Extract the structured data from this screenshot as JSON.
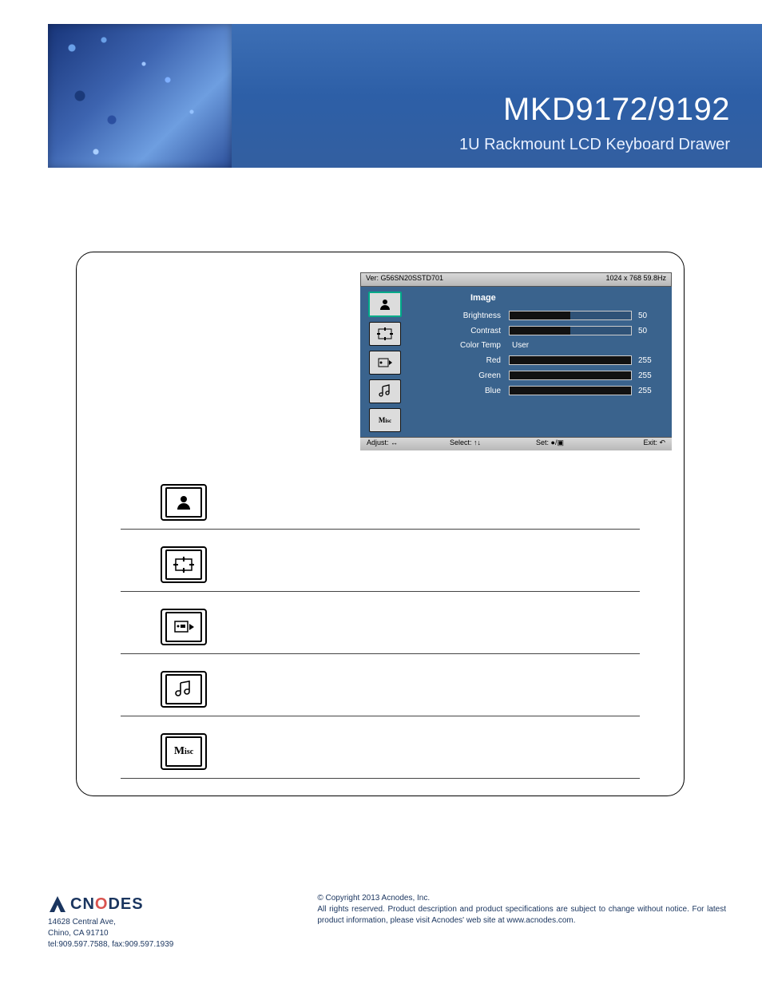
{
  "header": {
    "title": "MKD9172/9192",
    "subtitle": "1U Rackmount LCD Keyboard Drawer"
  },
  "osd": {
    "version": "Ver: G56SN20SSTD701",
    "resolution": "1024 x 768  59.8Hz",
    "section_title": "Image",
    "icons": [
      "image-icon",
      "geometry-icon",
      "color-icon",
      "audio-icon",
      "misc-icon"
    ],
    "params": [
      {
        "label": "Brightness",
        "value": "50",
        "pct": 50,
        "type": "bar"
      },
      {
        "label": "Contrast",
        "value": "50",
        "pct": 50,
        "type": "bar"
      },
      {
        "label": "Color Temp",
        "value": "User",
        "type": "text"
      },
      {
        "label": "Red",
        "value": "255",
        "pct": 100,
        "type": "bar"
      },
      {
        "label": "Green",
        "value": "255",
        "pct": 100,
        "type": "bar"
      },
      {
        "label": "Blue",
        "value": "255",
        "pct": 100,
        "type": "bar"
      }
    ],
    "foot": {
      "adjust": "Adjust: ↔",
      "select": "Select: ↑↓",
      "set": "Set: ●/▣",
      "exit": "Exit: ↶"
    }
  },
  "rows": [
    {
      "icon": "image-icon"
    },
    {
      "icon": "geometry-icon"
    },
    {
      "icon": "color-icon"
    },
    {
      "icon": "audio-icon"
    },
    {
      "icon": "misc-icon"
    }
  ],
  "footer": {
    "brand": "ACNODES",
    "addr1": "14628 Central Ave,",
    "addr2": "Chino, CA 91710",
    "contact": "tel:909.597.7588, fax:909.597.1939",
    "legal": "© Copyright 2013 Acnodes, Inc.\nAll rights reserved. Product description and product specifications are subject to change without notice. For latest product information, please visit Acnodes' web site at www.acnodes.com."
  }
}
